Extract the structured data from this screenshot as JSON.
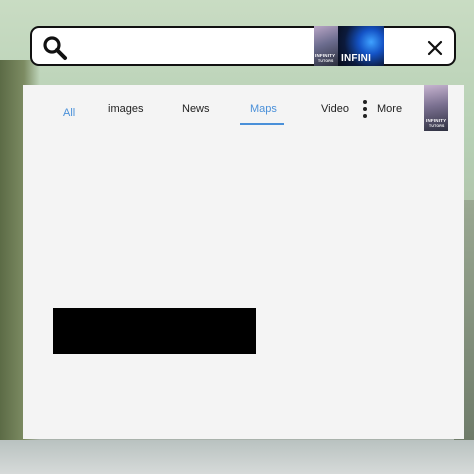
{
  "search": {
    "value": "",
    "thumbnail_caption": "INFINITY",
    "thumbnail_sub": "TUTORS",
    "thumbnail_wide_text": "INFINI"
  },
  "tabs": [
    {
      "label": "All",
      "active": true
    },
    {
      "label": "images",
      "active": false
    },
    {
      "label": "News",
      "active": false
    },
    {
      "label": "Maps",
      "active": true
    },
    {
      "label": "Video",
      "active": false
    },
    {
      "label": "More",
      "active": false
    }
  ],
  "side_thumbnail": {
    "caption": "INFINITY",
    "sub": "TUTORS"
  },
  "colors": {
    "accent": "#4a90d9",
    "panel": "#f4f4f4",
    "redaction": "#000000"
  },
  "icons": [
    "search-icon",
    "close-icon",
    "more-dots-icon"
  ]
}
